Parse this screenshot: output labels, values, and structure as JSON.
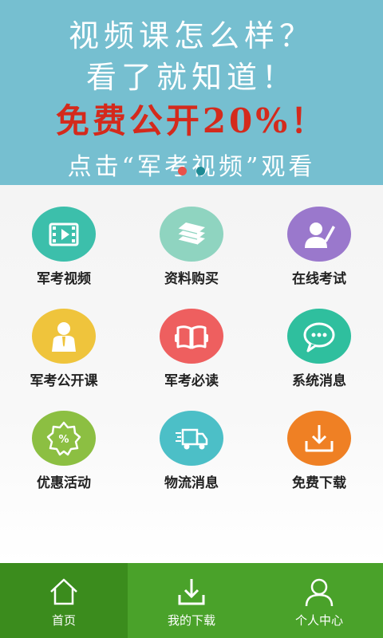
{
  "banner": {
    "line1": "视频课怎么样？",
    "line2": "看了就知道！",
    "line3": "免费公开20%！",
    "line4": "点击“军考视频”观看",
    "background": "#76bfd0",
    "dot_active_color": "#e8524a",
    "dot_inactive_color": "#1e8a94"
  },
  "menu": {
    "items": [
      {
        "label": "军考视频",
        "icon": "video-icon",
        "color": "#3cbfab"
      },
      {
        "label": "资料购买",
        "icon": "books-icon",
        "color": "#8fd4c0"
      },
      {
        "label": "在线考试",
        "icon": "writer-icon",
        "color": "#9a78cc"
      },
      {
        "label": "军考公开课",
        "icon": "presenter-icon",
        "color": "#efc43c"
      },
      {
        "label": "军考必读",
        "icon": "book-icon",
        "color": "#ee5f5f"
      },
      {
        "label": "系统消息",
        "icon": "chat-icon",
        "color": "#2fbf9e"
      },
      {
        "label": "优惠活动",
        "icon": "discount-badge-icon",
        "color": "#8cbf42"
      },
      {
        "label": "物流消息",
        "icon": "truck-icon",
        "color": "#4cbfc7"
      },
      {
        "label": "免费下载",
        "icon": "download-icon",
        "color": "#ef8024"
      }
    ]
  },
  "tabbar": {
    "tabs": [
      {
        "label": "首页",
        "icon": "home-icon",
        "active": true
      },
      {
        "label": "我的下载",
        "icon": "download-icon",
        "active": false
      },
      {
        "label": "个人中心",
        "icon": "user-icon",
        "active": false
      }
    ],
    "color": "#4aa22a",
    "active_color": "#3b8c1d"
  }
}
